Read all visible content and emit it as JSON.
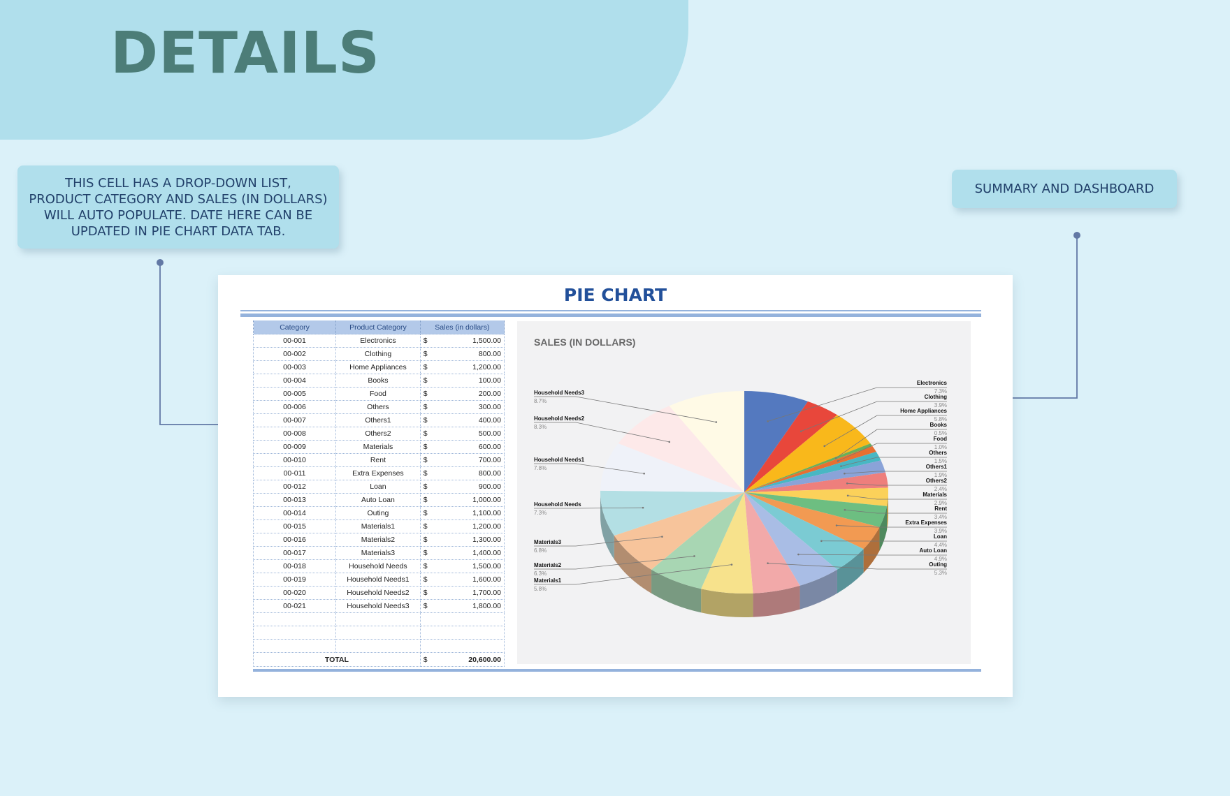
{
  "header": {
    "title": "DETAILS"
  },
  "callouts": {
    "left_lines": [
      "THIS CELL HAS A DROP-DOWN LIST,",
      "PRODUCT CATEGORY AND SALES (IN DOLLARS)",
      "WILL AUTO POPULATE. DATE HERE CAN BE",
      "UPDATED IN PIE CHART DATA TAB."
    ],
    "right": "SUMMARY AND DASHBOARD"
  },
  "card": {
    "title": "PIE CHART"
  },
  "table": {
    "headers": [
      "Category",
      "Product Category",
      "Sales (in dollars)"
    ],
    "currency_symbol": "$",
    "rows": [
      {
        "category": "00-001",
        "product": "Electronics",
        "sales": "1,500.00"
      },
      {
        "category": "00-002",
        "product": "Clothing",
        "sales": "800.00"
      },
      {
        "category": "00-003",
        "product": "Home Appliances",
        "sales": "1,200.00"
      },
      {
        "category": "00-004",
        "product": "Books",
        "sales": "100.00"
      },
      {
        "category": "00-005",
        "product": "Food",
        "sales": "200.00"
      },
      {
        "category": "00-006",
        "product": "Others",
        "sales": "300.00"
      },
      {
        "category": "00-007",
        "product": "Others1",
        "sales": "400.00"
      },
      {
        "category": "00-008",
        "product": "Others2",
        "sales": "500.00"
      },
      {
        "category": "00-009",
        "product": "Materials",
        "sales": "600.00"
      },
      {
        "category": "00-010",
        "product": "Rent",
        "sales": "700.00"
      },
      {
        "category": "00-011",
        "product": "Extra Expenses",
        "sales": "800.00"
      },
      {
        "category": "00-012",
        "product": "Loan",
        "sales": "900.00"
      },
      {
        "category": "00-013",
        "product": "Auto Loan",
        "sales": "1,000.00"
      },
      {
        "category": "00-014",
        "product": "Outing",
        "sales": "1,100.00"
      },
      {
        "category": "00-015",
        "product": "Materials1",
        "sales": "1,200.00"
      },
      {
        "category": "00-016",
        "product": "Materials2",
        "sales": "1,300.00"
      },
      {
        "category": "00-017",
        "product": "Materials3",
        "sales": "1,400.00"
      },
      {
        "category": "00-018",
        "product": "Household Needs",
        "sales": "1,500.00"
      },
      {
        "category": "00-019",
        "product": "Household Needs1",
        "sales": "1,600.00"
      },
      {
        "category": "00-020",
        "product": "Household Needs2",
        "sales": "1,700.00"
      },
      {
        "category": "00-021",
        "product": "Household Needs3",
        "sales": "1,800.00"
      }
    ],
    "empty_rows": 3,
    "total_label": "TOTAL",
    "total_value": "20,600.00"
  },
  "chart_data": {
    "type": "pie",
    "title": "SALES (IN DOLLARS)",
    "style": "3d",
    "categories": [
      "Electronics",
      "Clothing",
      "Home Appliances",
      "Books",
      "Food",
      "Others",
      "Others1",
      "Others2",
      "Materials",
      "Rent",
      "Extra Expenses",
      "Loan",
      "Auto Loan",
      "Outing",
      "Materials1",
      "Materials2",
      "Materials3",
      "Household Needs",
      "Household Needs1",
      "Household Needs2",
      "Household Needs3"
    ],
    "values": [
      1500,
      800,
      1200,
      100,
      200,
      300,
      400,
      500,
      600,
      700,
      800,
      900,
      1000,
      1100,
      1200,
      1300,
      1400,
      1500,
      1600,
      1700,
      1800
    ],
    "labels": [
      "7.3%",
      "3.9%",
      "5.8%",
      "0.5%",
      "1.0%",
      "1.5%",
      "1.9%",
      "2.4%",
      "2.9%",
      "3.4%",
      "3.9%",
      "4.4%",
      "4.9%",
      "5.3%",
      "5.8%",
      "6.3%",
      "6.8%",
      "7.3%",
      "7.8%",
      "8.3%",
      "8.7%"
    ],
    "colors": [
      "#5479bf",
      "#e8473b",
      "#f9b81b",
      "#6aaf5a",
      "#e76f32",
      "#48b7c3",
      "#8aa3d8",
      "#ee7f7c",
      "#fbd15a",
      "#6dbe81",
      "#f29a52",
      "#7bcbd3",
      "#a9bde5",
      "#f2a9a9",
      "#f7e28c",
      "#a8d6b3",
      "#f7c49b",
      "#b3dfe4",
      "#eff2f9",
      "#fde9e9",
      "#fffae6"
    ],
    "legend": "none"
  }
}
